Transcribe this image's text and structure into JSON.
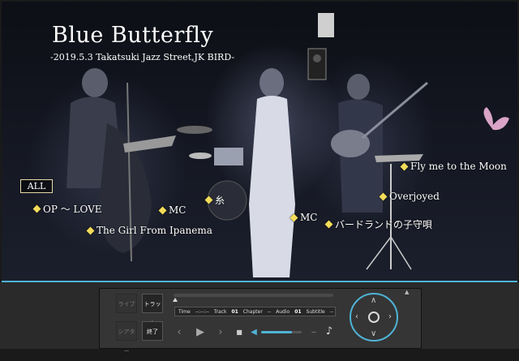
{
  "video": {
    "title": "Blue Butterfly",
    "subtitle": "-2019.5.3 Takatsuki Jazz Street,JK BIRD-"
  },
  "chapters": {
    "all_label": "ALL",
    "items": [
      {
        "label": "OP 〜 LOVE"
      },
      {
        "label": "The Girl From Ipanema"
      },
      {
        "label": "MC"
      },
      {
        "label": "糸"
      },
      {
        "label": "MC"
      },
      {
        "label": "バードランドの子守唄"
      },
      {
        "label": "Overjoyed"
      },
      {
        "label": "Fly me to the Moon"
      }
    ]
  },
  "controls": {
    "life_label": "ライブ",
    "track_label": "トラック",
    "theater_label": "シアター",
    "end_label": "終了",
    "info": {
      "time_label": "Time",
      "time_value": "--:--:--",
      "track_label": "Track",
      "track_value": "01",
      "chapter_label": "Chapter",
      "chapter_value": "--",
      "audio_label": "Audio",
      "audio_value": "01",
      "subtitle_label": "Subtitle",
      "subtitle_value": "--"
    },
    "volume_level": 0.75,
    "accent_color": "#4fb3d6"
  }
}
